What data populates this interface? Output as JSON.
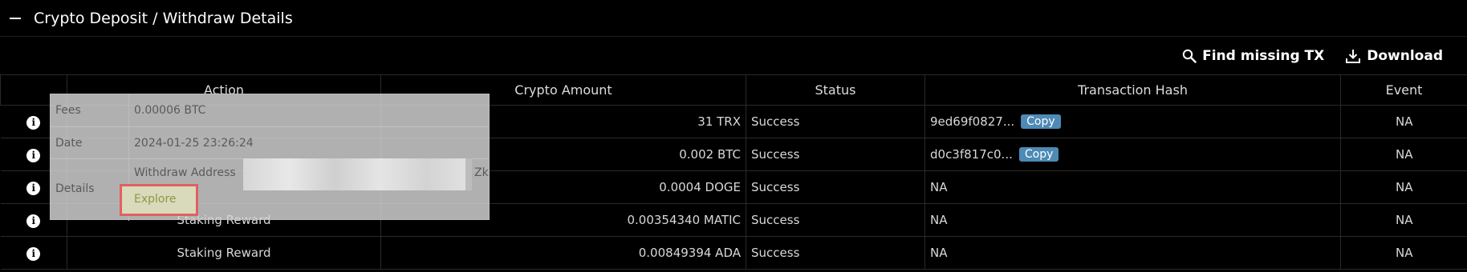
{
  "panel": {
    "title": "Crypto Deposit / Withdraw Details",
    "collapse_icon": "minus-icon"
  },
  "toolbar": {
    "find_label": "Find missing TX",
    "download_label": "Download"
  },
  "table": {
    "headers": {
      "info": "",
      "action": "Action",
      "amount": "Crypto Amount",
      "status": "Status",
      "hash": "Transaction Hash",
      "event": "Event"
    },
    "copy_label": "Copy",
    "rows": [
      {
        "action": "",
        "amount": "31 TRX",
        "status": "Success",
        "hash": "9ed69f0827...",
        "has_copy": true,
        "event": "NA"
      },
      {
        "action": "",
        "amount": "0.002 BTC",
        "status": "Success",
        "hash": "d0c3f817c0...",
        "has_copy": true,
        "event": "NA"
      },
      {
        "action": "",
        "amount": "0.0004 DOGE",
        "status": "Success",
        "hash": "NA",
        "has_copy": false,
        "event": "NA"
      },
      {
        "action": "Staking Reward",
        "amount": "0.00354340 MATIC",
        "status": "Success",
        "hash": "NA",
        "has_copy": false,
        "event": "NA"
      },
      {
        "action": "Staking Reward",
        "amount": "0.00849394 ADA",
        "status": "Success",
        "hash": "NA",
        "has_copy": false,
        "event": "NA"
      }
    ]
  },
  "popover": {
    "fees_label": "Fees",
    "fees_value": "0.00006 BTC",
    "date_label": "Date",
    "date_value": "2024-01-25 23:26:24",
    "details_label": "Details",
    "withdraw_address_label": "Withdraw Address",
    "address_tail": "Zk",
    "explore_label": "Explore"
  }
}
